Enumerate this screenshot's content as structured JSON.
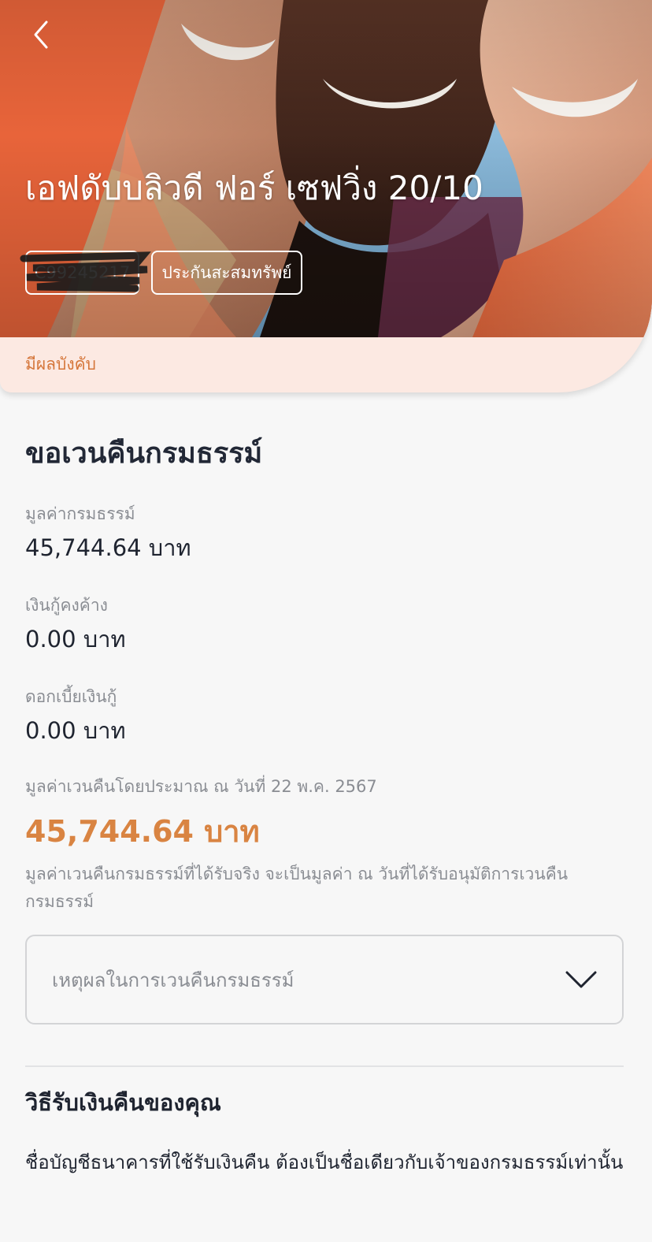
{
  "hero": {
    "title": "เอฟดับบลิวดี ฟอร์ เซฟวิ่ง 20/10",
    "policy_number": "C99245217",
    "policy_type": "ประกันสะสมทรัพย์",
    "status": "มีผลบังคับ",
    "back_icon": "chevron-left-icon"
  },
  "main": {
    "section_title": "ขอเวนคืนกรมธรรม์",
    "fields": [
      {
        "label": "มูลค่ากรมธรรม์",
        "value": "45,744.64 บาท"
      },
      {
        "label": "เงินกู้คงค้าง",
        "value": "0.00 บาท"
      },
      {
        "label": "ดอกเบี้ยเงินกู้",
        "value": "0.00 บาท"
      }
    ],
    "estimate_label": "มูลค่าเวนคืนโดยประมาณ ณ วันที่ 22 พ.ค. 2567",
    "estimate_value": "45,744.64 บาท",
    "estimate_note": "มูลค่าเวนคืนกรมธรรม์ที่ได้รับจริง จะเป็นมูลค่า ณ วันที่ได้รับอนุมัติการเวนคืนกรมธรรม์",
    "reason_placeholder": "เหตุผลในการเวนคืนกรมธรรม์",
    "refund_title": "วิธีรับเงินคืนของคุณ",
    "refund_text": "ชื่อบัญชีธนาคารที่ใช้รับเงินคืน ต้องเป็นชื่อเดียวกับเจ้าของกรมธรรม์เท่านั้น"
  },
  "colors": {
    "brand_orange": "#e8643a",
    "amount_orange": "#d98442",
    "status_bg": "#fce9e2"
  }
}
